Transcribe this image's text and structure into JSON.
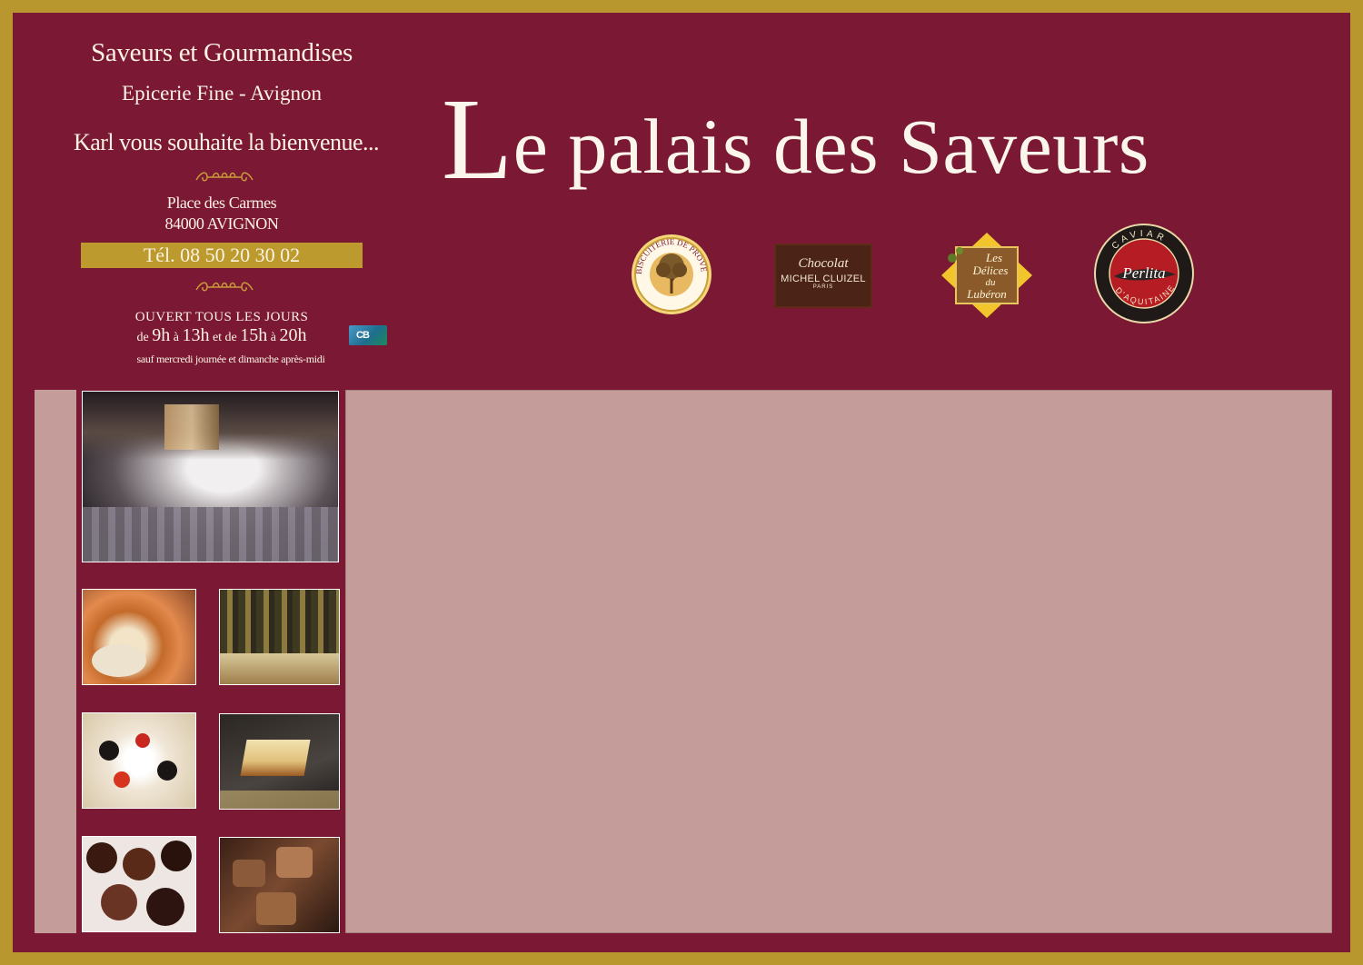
{
  "header": {
    "shop_name": "Saveurs et Gourmandises",
    "subtitle": "Epicerie Fine - Avignon",
    "welcome": "Karl vous souhaite la bienvenue...",
    "address_line1": "Place des Carmes",
    "address_line2": "84000 AVIGNON",
    "phone": "Tél. 08 50 20 30 02",
    "open_text": "OUVERT TOUS LES JOURS",
    "hours": {
      "de1": "de ",
      "start1": "9h",
      "a1": " à ",
      "end1": "13h",
      "etde": " et de ",
      "start2": "15h",
      "a2": " à ",
      "end2": "20h"
    },
    "closed_note": "sauf mercredi journée et dimanche après-midi",
    "payment_badge": "CB"
  },
  "title": {
    "first_letter": "L",
    "rest": "e palais des Saveurs"
  },
  "logos": {
    "biscuiterie": "BISCUITERIE DE PROVENCE",
    "cluizel_top": "Chocolat",
    "cluizel_name": "MICHEL CLUIZEL",
    "cluizel_city": "PARIS",
    "delices_line1": "Les",
    "delices_line2": "Délices",
    "delices_line3": "du",
    "delices_line4": "Lubéron",
    "caviar_top": "CAVIAR",
    "caviar_brand": "Perlita",
    "caviar_bottom": "D'AQUITAINE"
  },
  "colors": {
    "border_gold": "#B8972E",
    "background_burgundy": "#7B1833",
    "content_pink": "#C49D9A",
    "text_cream": "#FBF2E4"
  },
  "gallery": [
    "shop-table-photo",
    "gourmet-platter-photo",
    "shelves-photo",
    "canapes-photo",
    "foie-gras-slate-photo",
    "chocolate-truffles-photo",
    "chocolate-pralines-photo"
  ]
}
